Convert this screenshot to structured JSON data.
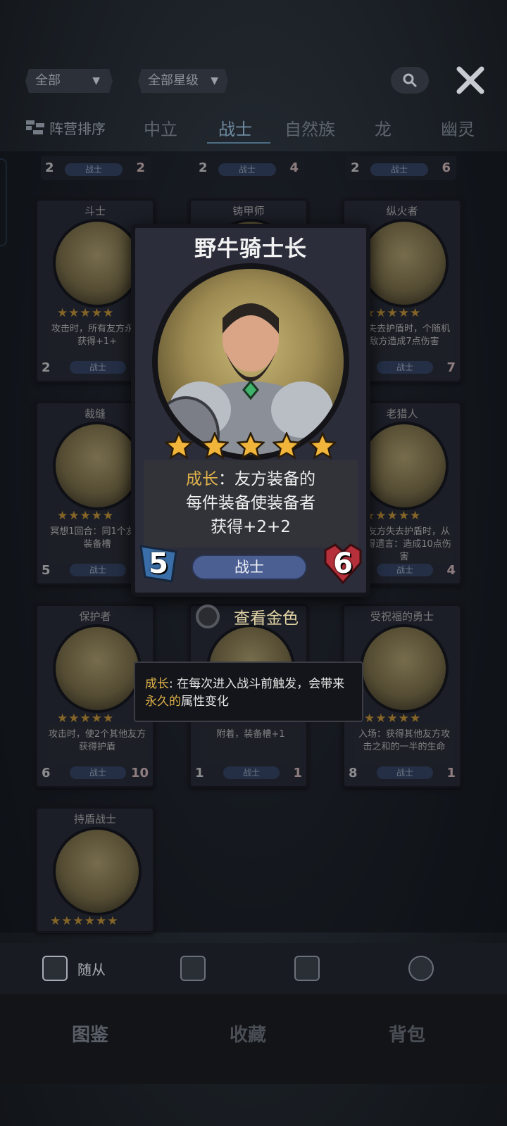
{
  "filters": {
    "category": "全部",
    "stars": "全部星级"
  },
  "tabs": {
    "sort_label": "阵营排序",
    "items": [
      "中立",
      "战士",
      "自然族",
      "龙",
      "幽灵"
    ],
    "active": "战士"
  },
  "grid": {
    "top_row": [
      {
        "atk": "2",
        "tribe": "战士",
        "hp": "2"
      },
      {
        "atk": "2",
        "tribe": "战士",
        "hp": "4"
      },
      {
        "atk": "2",
        "tribe": "战士",
        "hp": "6"
      }
    ],
    "cards": [
      {
        "name": "斗士",
        "desc": "攻击时，所有友方永久获得+1+",
        "atk": "2",
        "tribe": "战士",
        "hp": "",
        "stars": "★★★★★"
      },
      {
        "name": "铸甲师",
        "desc": "",
        "atk": "",
        "tribe": "",
        "hp": "",
        "stars": ""
      },
      {
        "name": "纵火者",
        "desc": "，失去护盾时，个随机敌方造成7点伤害",
        "atk": "",
        "tribe": "战士",
        "hp": "7",
        "stars": "★★★★★"
      },
      {
        "name": "裁缝",
        "desc": "冥想1回合：同1个友方装备槽",
        "atk": "5",
        "tribe": "战士",
        "hp": "",
        "stars": "★★★★★"
      },
      {
        "name": "老猎人",
        "desc": "，友方失去护盾时，从获得遗言：造成10点伤害",
        "atk": "",
        "tribe": "战士",
        "hp": "4",
        "stars": "★★★★★"
      },
      {
        "name": "保护者",
        "desc": "攻击时，使2个其他友方获得护盾",
        "atk": "6",
        "tribe": "战士",
        "hp": "10",
        "stars": "★★★★★"
      },
      {
        "name": "",
        "desc": "附着，装备槽+1",
        "atk": "1",
        "tribe": "战士",
        "hp": "1",
        "stars": "★★★★★"
      },
      {
        "name": "受祝福的勇士",
        "desc": "入场：获得其他友方攻击之和的一半的生命",
        "atk": "8",
        "tribe": "战士",
        "hp": "1",
        "stars": "★★★★★"
      },
      {
        "name": "持盾战士",
        "desc": "",
        "atk": "",
        "tribe": "",
        "hp": "",
        "stars": "★★★★★★"
      }
    ]
  },
  "featured": {
    "name": "野牛骑士长",
    "stars": 5,
    "desc_keyword": "成长",
    "desc_rest_1": "：友方装备的",
    "desc_line_2": "每件装备使装备者",
    "desc_line_3": "获得+2+2",
    "tribe": "战士",
    "atk": "5",
    "hp": "6"
  },
  "gold_toggle": {
    "label": "查看金色",
    "checked": false
  },
  "tooltip": {
    "keyword": "成长",
    "text_1": ": 在每次进入战斗前触发，会带来",
    "keyword_2": "永久的",
    "text_2": "属性变化"
  },
  "subnav": [
    "随从",
    "",
    "",
    ""
  ],
  "mainnav": [
    "图鉴",
    "收藏",
    "背包"
  ],
  "colors": {
    "keyword_gold": "#e0b34a",
    "tab_active": "#6f8ca2",
    "tribe_pill": "#4c5f93",
    "hp_red": "#b5303a",
    "atk_blue": "#3a6ea8"
  }
}
